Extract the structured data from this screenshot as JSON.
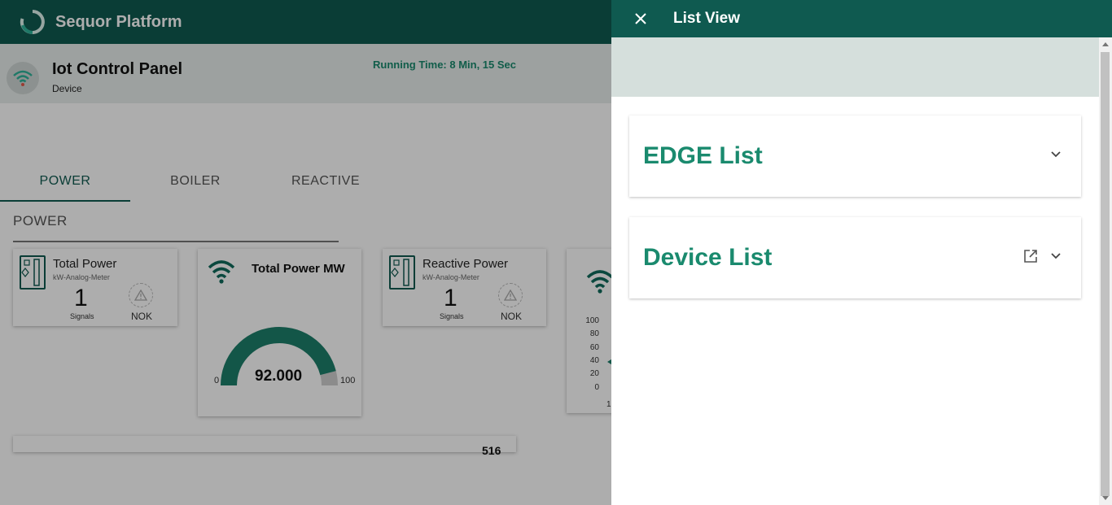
{
  "app": {
    "brand": "Sequor Platform",
    "device_title": "Iot Control Panel",
    "device_subtitle": "Device",
    "running_time": "Running Time: 8 Min, 15 Sec",
    "tabs": [
      {
        "label": "POWER",
        "active": true
      },
      {
        "label": "BOILER",
        "active": false
      },
      {
        "label": "REACTIVE",
        "active": false
      }
    ],
    "section_title": "POWER",
    "cards": [
      {
        "name": "Total Power",
        "type": "kW-Analog-Meter",
        "count": "1",
        "signals_label": "Signals",
        "status": "NOK"
      },
      {
        "name": "Reactive Power",
        "type": "kW-Analog-Meter",
        "count": "1",
        "signals_label": "Signals",
        "status": "NOK"
      }
    ],
    "gauge": {
      "title": "Total Power MW",
      "value": "92.000",
      "min": "0",
      "max": "100",
      "fraction": 0.92
    },
    "axis_ticks": [
      "100",
      "80",
      "60",
      "40",
      "20",
      "0"
    ],
    "partial_text": "516",
    "partial_axis": "1"
  },
  "drawer": {
    "title": "List View",
    "lists": [
      {
        "title": "EDGE List",
        "has_external": false
      },
      {
        "title": "Device List",
        "has_external": true
      }
    ]
  },
  "colors": {
    "primary": "#0f5a50",
    "accent": "#1a8a6e",
    "band": "#d5dfdc"
  },
  "icons": {
    "logo": "sequor-logo-icon",
    "device": "wifi-icon",
    "meter": "meter-icon",
    "warning": "warning-icon",
    "close": "close-icon",
    "expand": "chevron-down-icon",
    "external": "open-in-new-icon"
  }
}
